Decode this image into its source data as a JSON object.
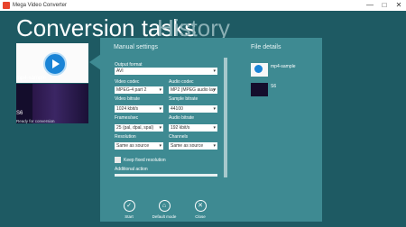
{
  "window": {
    "title": "Mega Video Converter",
    "minimize": "—",
    "maximize": "□",
    "close": "✕"
  },
  "header": {
    "tab_active": "Conversion tasks",
    "tab_inactive": "History"
  },
  "tasks": [
    {
      "label": "mp4-sample"
    },
    {
      "label": "S6",
      "status": "Ready for conversion"
    }
  ],
  "manual": {
    "title": "Manual settings",
    "output_format_label": "Output format",
    "output_format_value": "AVI",
    "video_codec_label": "Video codec",
    "video_codec_value": "MPEG-4 part 2",
    "audio_codec_label": "Audio codec",
    "audio_codec_value": "MP2 (MPEG audio lay",
    "video_bitrate_label": "Video bitrate",
    "video_bitrate_value": "1024 kbit/s",
    "sample_bitrate_label": "Sample bitrate",
    "sample_bitrate_value": "44100",
    "frames_label": "Frames/sec",
    "frames_value": "25 (pal, dpal, spal)",
    "audio_bitrate_label": "Audio bitrate",
    "audio_bitrate_value": "192 kbit/s",
    "resolution_label": "Resolution",
    "resolution_value": "Same as source",
    "channels_label": "Channels",
    "channels_value": "Same as source",
    "fixed_res_label": "Keep fixed resolution",
    "additional_label": "Additional action"
  },
  "file_details": {
    "title": "File details",
    "files": [
      {
        "name": "mp4-sample"
      },
      {
        "name": "S6"
      }
    ]
  },
  "actions": {
    "start": "Start",
    "default": "Default mode",
    "close": "Close"
  }
}
